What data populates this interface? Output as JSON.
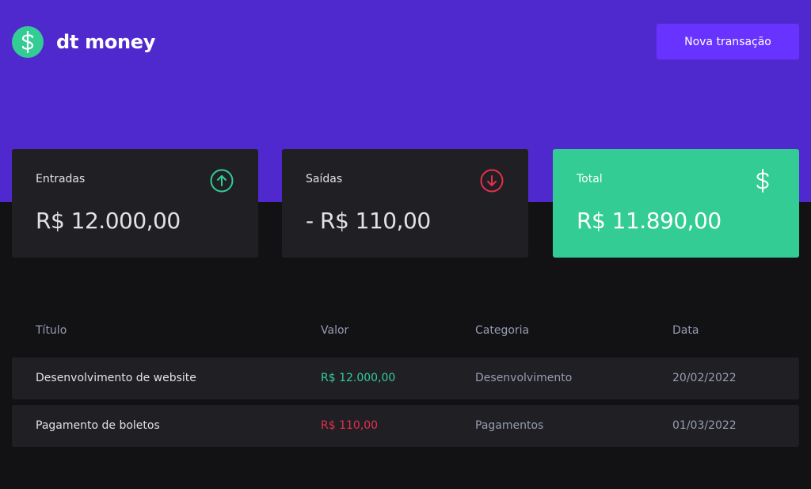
{
  "header": {
    "app_name": "dt money",
    "logo_icon": "dollar-icon",
    "new_transaction_label": "Nova transação"
  },
  "summary": [
    {
      "label": "Entradas",
      "value": "R$ 12.000,00",
      "icon": "arrow-circle-up-icon",
      "icon_color": "#33cc95"
    },
    {
      "label": "Saídas",
      "value": "- R$ 110,00",
      "icon": "arrow-circle-down-icon",
      "icon_color": "#e52e4d"
    },
    {
      "label": "Total",
      "value": "R$ 11.890,00",
      "icon": "dollar-icon",
      "icon_color": "#ffffff"
    }
  ],
  "table": {
    "headers": [
      "Título",
      "Valor",
      "Categoria",
      "Data"
    ],
    "rows": [
      {
        "title": "Desenvolvimento de website",
        "amount": "R$ 12.000,00",
        "type": "deposit",
        "category": "Desenvolvimento",
        "date": "20/02/2022"
      },
      {
        "title": "Pagamento de boletos",
        "amount": "R$ 110,00",
        "type": "withdraw",
        "category": "Pagamentos",
        "date": "01/03/2022"
      }
    ]
  },
  "colors": {
    "header_bg": "#5029ce",
    "button_bg": "#6933ff",
    "green": "#33cc95",
    "red": "#e52e4d",
    "page_bg": "#121214",
    "card_bg": "#202024"
  }
}
